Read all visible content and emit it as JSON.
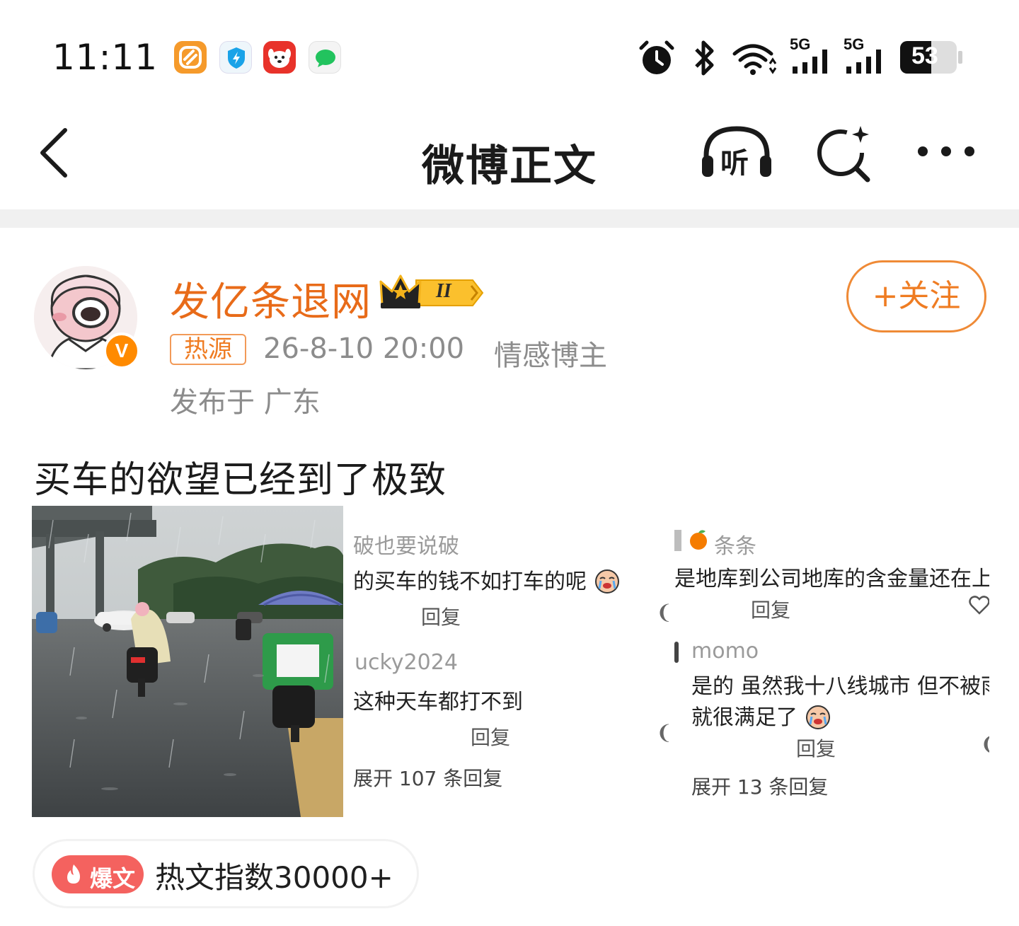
{
  "status_bar": {
    "time": "11:11",
    "apps": [
      "orange-app-icon",
      "shield-app-icon",
      "dog-app-icon",
      "chat-app-icon"
    ],
    "signal_labels": [
      "5G",
      "5G"
    ],
    "battery": "53"
  },
  "nav": {
    "title": "微博正文",
    "listen_label": "听"
  },
  "author": {
    "name": "发亿条退网",
    "verify_mark": "V",
    "level_badge": "II",
    "follow_label": "+关注",
    "hot_tag": "热源",
    "time": "26-8-10 20:00",
    "role": "情感博主",
    "location": "发布于 广东"
  },
  "post": {
    "text": "买车的欲望已经到了极致"
  },
  "screenshot1": {
    "c1_user": "破也要说破",
    "c1_text": "的买车的钱不如打车的呢",
    "c1_reply": "回复",
    "c2_user": "ucky2024",
    "c2_text": "这种天车都打不到",
    "c2_reply": "回复",
    "expand": "展开 107 条回复"
  },
  "screenshot2": {
    "c1_user": "条条",
    "c1_text": "是地库到公司地库的含金量还在上升",
    "c1_reply": "回复",
    "c2_user": "momo",
    "c2_text_line1": "是的 虽然我十八线城市 但不被雨淋",
    "c2_text_line2": "就很满足了",
    "c2_reply": "回复",
    "expand": "展开 13 条回复"
  },
  "hot_index": {
    "badge": "爆文",
    "text": "热文指数30000+"
  },
  "colors": {
    "accent_orange": "#e86b19",
    "hot_red": "#f4625f"
  }
}
